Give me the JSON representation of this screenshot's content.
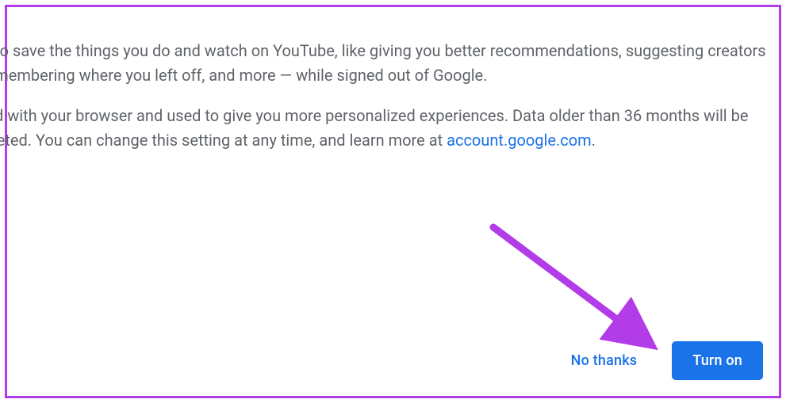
{
  "body": {
    "para1_a": "Choose whether to save the things you do and watch on YouTube, like giving you better recommendations, suggesting creators you might like, remembering where you left off, and more — while signed out of Google.",
    "para2_a": "This data is saved with your browser and used to give you more personalized experiences. Data older than 36 months will be automatically deleted. You can change this setting at any time, and learn more at ",
    "link_text": "account.google.com",
    "para2_b": "."
  },
  "actions": {
    "no_thanks": "No thanks",
    "turn_on": "Turn on"
  },
  "annotation": {
    "arrow_color": "#b23ce8"
  }
}
